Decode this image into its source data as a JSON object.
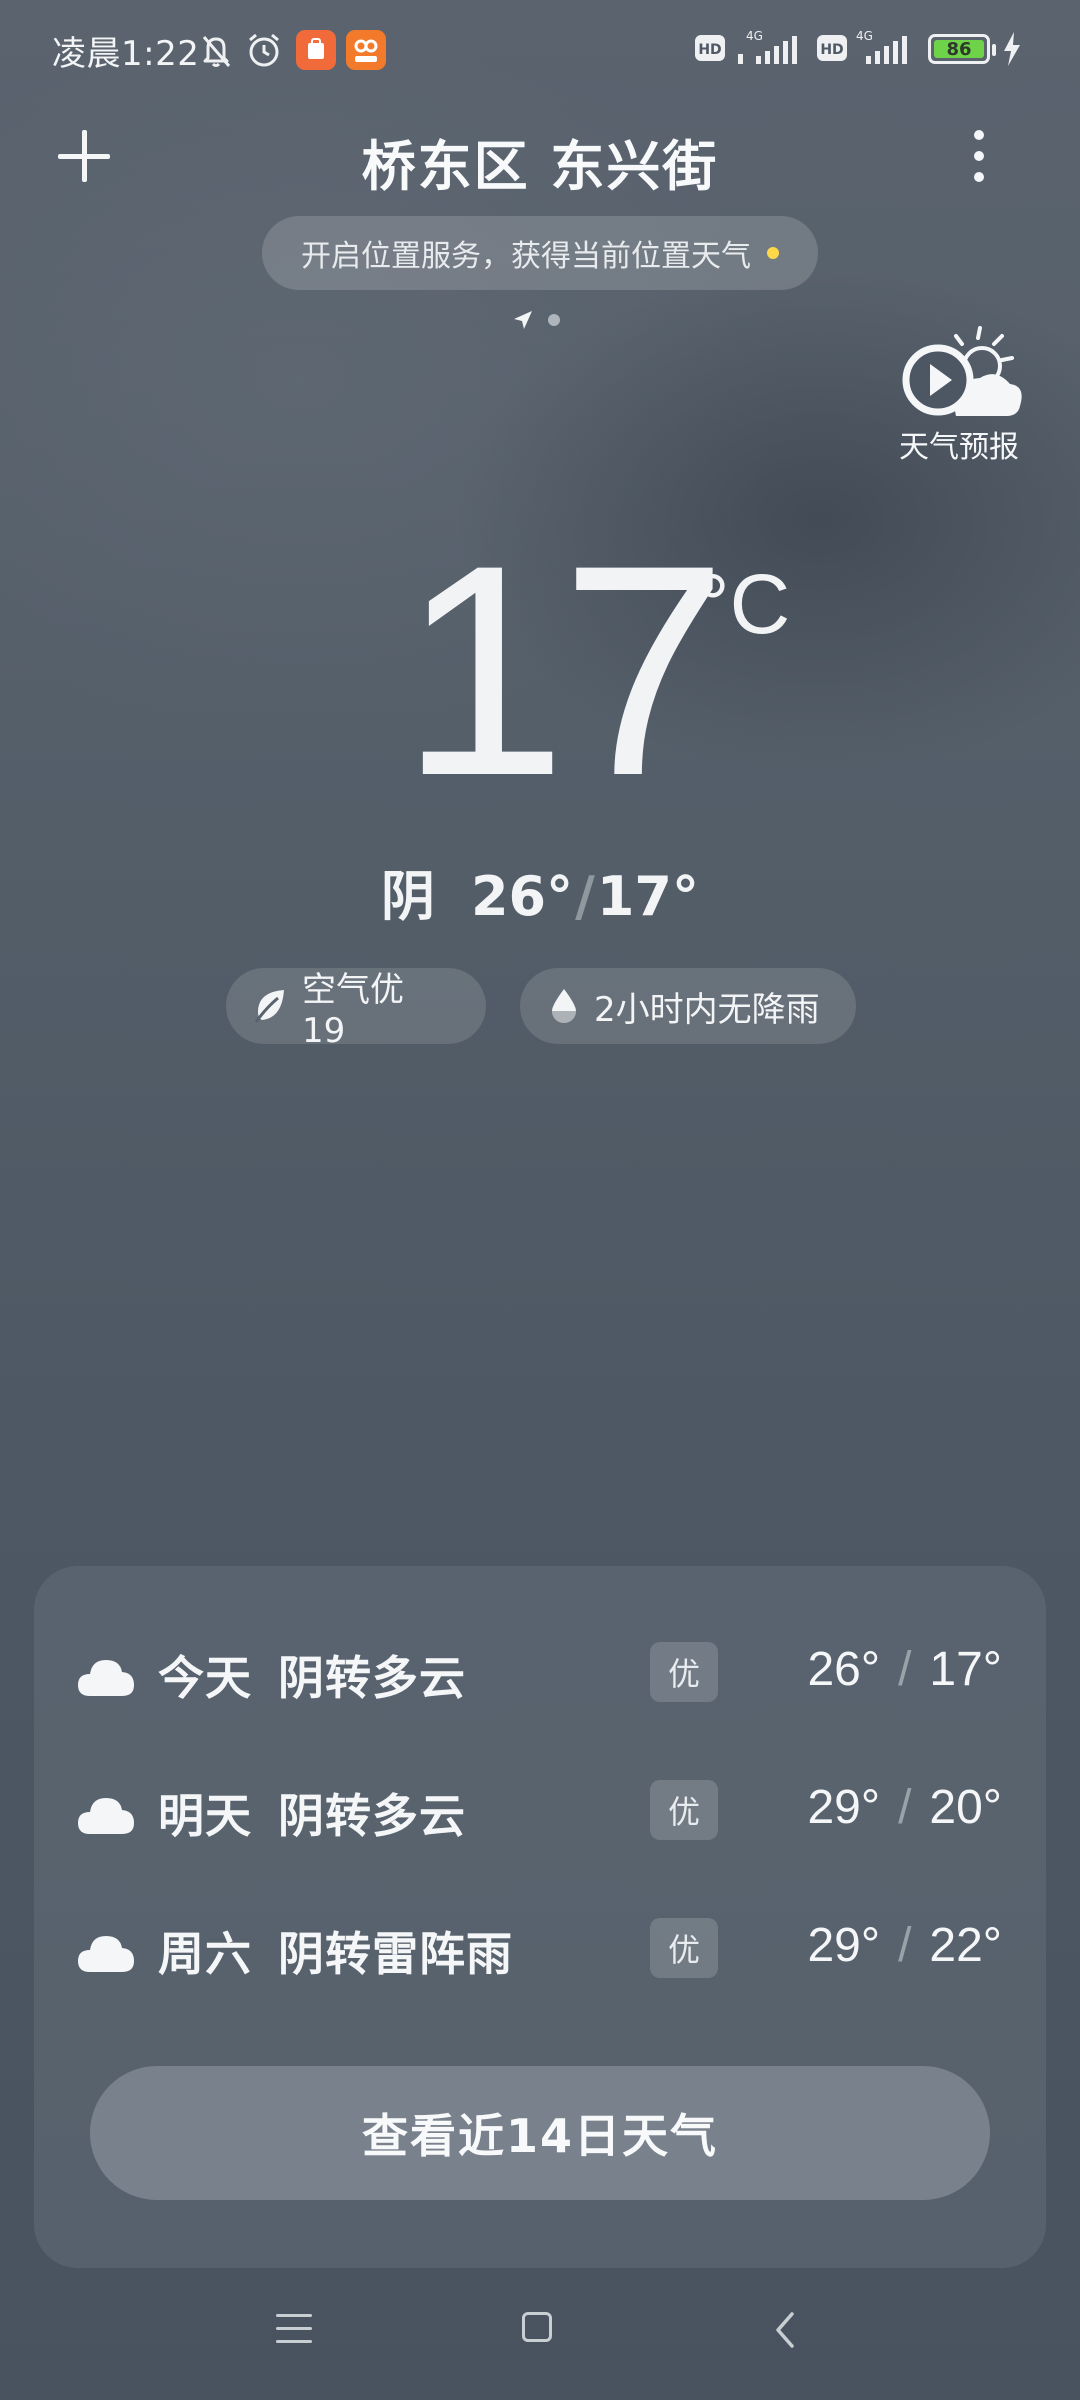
{
  "status_bar": {
    "time": "凌晨1:22",
    "battery": "86",
    "network_1": "4G",
    "network_2": "4G",
    "hd_label": "HD"
  },
  "header": {
    "title": "桥东区 东兴街",
    "location_prompt": "开启位置服务，获得当前位置天气"
  },
  "forecast_video": {
    "label": "天气预报"
  },
  "current": {
    "temperature": "17",
    "unit": "°C",
    "condition": "阴",
    "high": "26°",
    "separator": "/",
    "low": "17°"
  },
  "chips": {
    "air_quality": "空气优 19",
    "rain": "2小时内无降雨"
  },
  "forecast": [
    {
      "day": "今天",
      "condition": "阴转多云",
      "aqi": "优",
      "high": "26°",
      "low": "17°"
    },
    {
      "day": "明天",
      "condition": "阴转多云",
      "aqi": "优",
      "high": "29°",
      "low": "20°"
    },
    {
      "day": "周六",
      "condition": "阴转雷阵雨",
      "aqi": "优",
      "high": "29°",
      "low": "22°"
    }
  ],
  "forecast_separator": "/",
  "cta": {
    "label": "查看近14日天气"
  },
  "colors": {
    "background": "#4f5965",
    "battery_fill": "#6fd34a",
    "indicator_dot": "#ffd84a"
  },
  "icons": {
    "add": "plus-icon",
    "more": "more-vertical-icon",
    "leaf": "leaf-icon",
    "drop": "water-drop-icon",
    "cloud": "cloud-icon",
    "navigation": "navigation-arrow-icon"
  }
}
